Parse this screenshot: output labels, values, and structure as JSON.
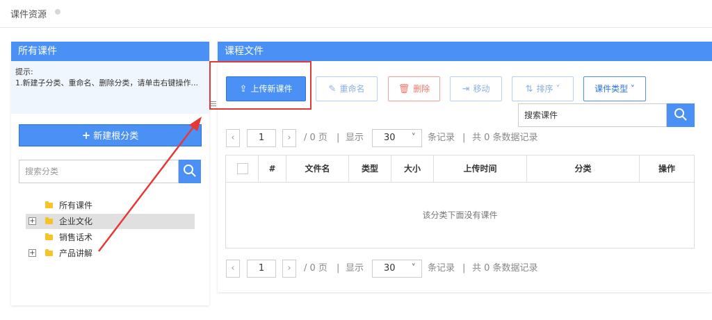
{
  "topbar": {
    "title": "课件资源"
  },
  "left": {
    "header": "所有课件",
    "tip_title": "提示:",
    "tip_body": "1.新建子分类、重命名、删除分类，请单击右键操作...",
    "new_root_label": "新建根分类",
    "search_placeholder": "搜索分类",
    "tree": [
      {
        "label": "所有课件",
        "expandable": false,
        "selected": false
      },
      {
        "label": "企业文化",
        "expandable": true,
        "selected": true
      },
      {
        "label": "销售话术",
        "expandable": false,
        "selected": false
      },
      {
        "label": "产品讲解",
        "expandable": true,
        "selected": false
      }
    ]
  },
  "right": {
    "header": "课程文件",
    "toolbar": {
      "upload": "上传新课件",
      "rename": "重命名",
      "delete": "删除",
      "move": "移动",
      "sort": "排序",
      "type": "课件类型"
    },
    "search_value": "搜索课件",
    "pager": {
      "page_value": "1",
      "pages_text": "/ 0 页",
      "sep": "|",
      "show_text": "显示",
      "page_size": "30",
      "records_text": "条记录",
      "total_text": "共 0 条数据记录"
    },
    "table": {
      "columns": [
        "#",
        "文件名",
        "类型",
        "大小",
        "上传时间",
        "分类",
        "操作"
      ],
      "empty_text": "该分类下面没有课件"
    }
  },
  "colors": {
    "accent": "#4a90f5",
    "annotation": "#e53935",
    "folder": "#f7c325",
    "danger": "#f0766e"
  },
  "icons": {
    "upload": "upload-icon",
    "rename": "pencil-icon",
    "delete": "trash-icon",
    "move": "move-icon",
    "sort": "sort-icon",
    "search": "search-icon",
    "folder": "folder-icon"
  }
}
